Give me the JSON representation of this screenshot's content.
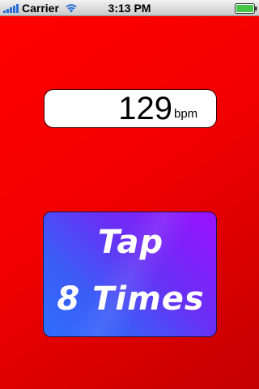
{
  "status_bar": {
    "carrier": "Carrier",
    "time": "3:13 PM",
    "signal_icon": "signal-bars-icon",
    "wifi_icon": "wifi-icon",
    "battery_icon": "battery-icon"
  },
  "bpm": {
    "value": "129",
    "unit": "bpm"
  },
  "tap_button": {
    "line1": "Tap",
    "line2": "8 Times"
  },
  "colors": {
    "background": "#ff0000",
    "button_gradient_start": "#9b10ff",
    "button_gradient_end": "#2f6dff"
  }
}
